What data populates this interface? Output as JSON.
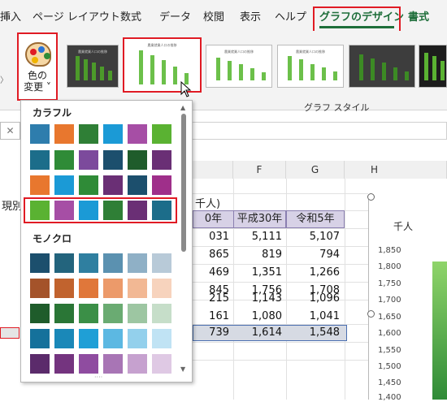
{
  "ribbon_tabs": [
    {
      "label": "挿入"
    },
    {
      "label": "ページ レイアウト"
    },
    {
      "label": "数式"
    },
    {
      "label": "データ"
    },
    {
      "label": "校閲"
    },
    {
      "label": "表示"
    },
    {
      "label": "ヘルプ"
    },
    {
      "label": "グラフのデザイン"
    },
    {
      "label": "書式"
    }
  ],
  "ribbon": {
    "change_color_line1": "色の",
    "change_color_line2": "変更 ˅",
    "group_label": "グラフ スタイル",
    "selected_style_index": 1,
    "style_thumb_titles": [
      "農業就業人口の推移",
      "農業就業人口の推移",
      "農業就業人口の推移",
      "農業就業人口の推移"
    ]
  },
  "dropdown": {
    "colorful_title": "カラフル",
    "mono_title": "モノクロ",
    "colorful_rows": [
      [
        "#2e7dad",
        "#e8772e",
        "#2f7f36",
        "#1b9ad6",
        "#a64ea5",
        "#5ab232"
      ],
      [
        "#1c6d8a",
        "#2f8b37",
        "#7c4a9c",
        "#1c4f6d",
        "#1f5c2b",
        "#6a2f75"
      ],
      [
        "#e8772e",
        "#1b9ad6",
        "#2f8b37",
        "#6a2f75",
        "#1c4f6d",
        "#9f2f8a"
      ],
      [
        "#5ab232",
        "#a64ea5",
        "#1b9ad6",
        "#2f7f36",
        "#6a2f75",
        "#1c6d8a"
      ]
    ],
    "selected_row": 3,
    "mono_rows": [
      [
        "#1c4f6d",
        "#23647d",
        "#2f7fa0",
        "#5b91b0",
        "#8fb0c6",
        "#b8cad8"
      ],
      [
        "#a4532a",
        "#c1632e",
        "#e0773a",
        "#ec9a6a",
        "#f2b894",
        "#f7d3bd"
      ],
      [
        "#1f5c2b",
        "#2a7636",
        "#3b8f47",
        "#6aab72",
        "#9dc6a2",
        "#c6dec9"
      ],
      [
        "#15719b",
        "#1a88b8",
        "#1f9fd6",
        "#5cb8e2",
        "#93d0ec",
        "#c0e3f4"
      ],
      [
        "#5b2b6b",
        "#74347f",
        "#8f4ca0",
        "#a875b5",
        "#c6a1cf",
        "#dfc9e4"
      ]
    ]
  },
  "sheet": {
    "col_headers": [
      {
        "label": "F"
      },
      {
        "label": "G"
      },
      {
        "label": "H"
      }
    ],
    "partial_text_left": "現別",
    "unit_label": "千人)",
    "header_cells": [
      "0年",
      "平成30年",
      "令和5年"
    ],
    "rows": [
      [
        "031",
        "5,111",
        "5,107"
      ],
      [
        "865",
        "819",
        "794"
      ],
      [
        "469",
        "1,351",
        "1,266"
      ],
      [
        "845",
        "1,756",
        "1,708"
      ],
      [
        "215",
        "1,143",
        "1,096"
      ],
      [
        "161",
        "1,080",
        "1,041"
      ],
      [
        "739",
        "1,614",
        "1,548"
      ]
    ]
  },
  "chart": {
    "unit_label": "千人",
    "y_ticks": [
      "1,850",
      "1,800",
      "1,750",
      "1,700",
      "1,650",
      "1,600",
      "1,550",
      "1,500",
      "1,450",
      "1,400"
    ]
  }
}
